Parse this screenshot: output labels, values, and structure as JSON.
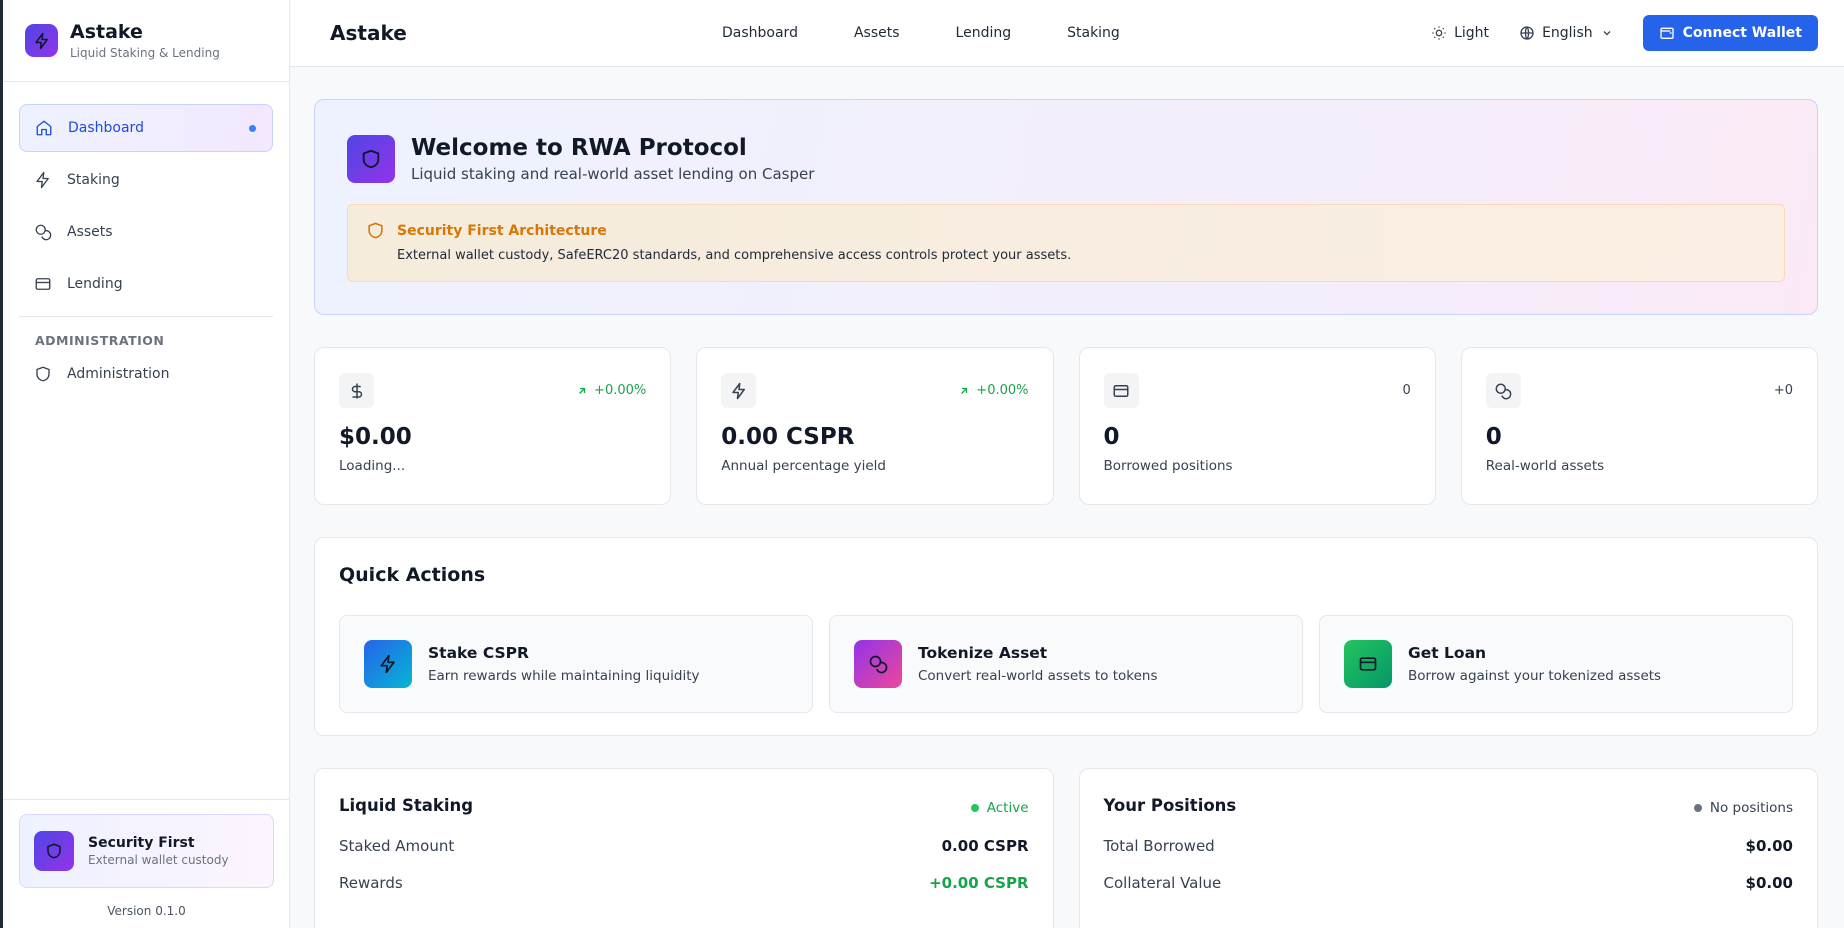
{
  "brand": {
    "name": "Astake",
    "subtitle": "Liquid Staking & Lending"
  },
  "sidebar": {
    "items": [
      {
        "label": "Dashboard",
        "icon": "home-icon",
        "active": true
      },
      {
        "label": "Staking",
        "icon": "bolt-icon"
      },
      {
        "label": "Assets",
        "icon": "coins-icon"
      },
      {
        "label": "Lending",
        "icon": "credit-card-icon"
      }
    ],
    "admin_section": "ADMINISTRATION",
    "admin_item": {
      "label": "Administration",
      "icon": "shield-icon"
    },
    "footer": {
      "title": "Security First",
      "subtitle": "External wallet custody",
      "version": "Version 0.1.0"
    }
  },
  "header": {
    "title": "Astake",
    "nav": [
      "Dashboard",
      "Assets",
      "Lending",
      "Staking"
    ],
    "theme_label": "Light",
    "language_label": "English",
    "connect_label": "Connect Wallet"
  },
  "hero": {
    "title": "Welcome to RWA Protocol",
    "subtitle": "Liquid staking and real-world asset lending on Casper",
    "note_title": "Security First Architecture",
    "note_text": "External wallet custody, SafeERC20 standards, and comprehensive access controls protect your assets."
  },
  "stats": [
    {
      "icon": "dollar-icon",
      "change": "+0.00%",
      "value": "$0.00",
      "label": "Loading..."
    },
    {
      "icon": "bolt-icon",
      "change": "+0.00%",
      "value": "0.00 CSPR",
      "label": "Annual percentage yield"
    },
    {
      "icon": "credit-card-icon",
      "change": "0",
      "value": "0",
      "label": "Borrowed positions"
    },
    {
      "icon": "coins-icon",
      "change": "+0",
      "value": "0",
      "label": "Real-world assets"
    }
  ],
  "quick_actions": {
    "title": "Quick Actions",
    "items": [
      {
        "name": "Stake CSPR",
        "desc": "Earn rewards while maintaining liquidity",
        "color": "#2563eb"
      },
      {
        "name": "Tokenize Asset",
        "desc": "Convert real-world assets to tokens",
        "color": "#c026d3"
      },
      {
        "name": "Get Loan",
        "desc": "Borrow against your tokenized assets",
        "color": "#16a34a"
      }
    ]
  },
  "staking_panel": {
    "title": "Liquid Staking",
    "status": "Active",
    "rows": [
      {
        "label": "Staked Amount",
        "value": "0.00 CSPR"
      },
      {
        "label": "Rewards",
        "value": "+0.00 CSPR"
      }
    ]
  },
  "positions_panel": {
    "title": "Your Positions",
    "status": "No positions",
    "rows": [
      {
        "label": "Total Borrowed",
        "value": "$0.00"
      },
      {
        "label": "Collateral Value",
        "value": "$0.00"
      }
    ]
  },
  "colors": {
    "accent": "#2563eb",
    "success": "#16a34a",
    "warning": "#d97706",
    "brand_gradient_start": "#4f46e5",
    "brand_gradient_end": "#9333ea"
  }
}
